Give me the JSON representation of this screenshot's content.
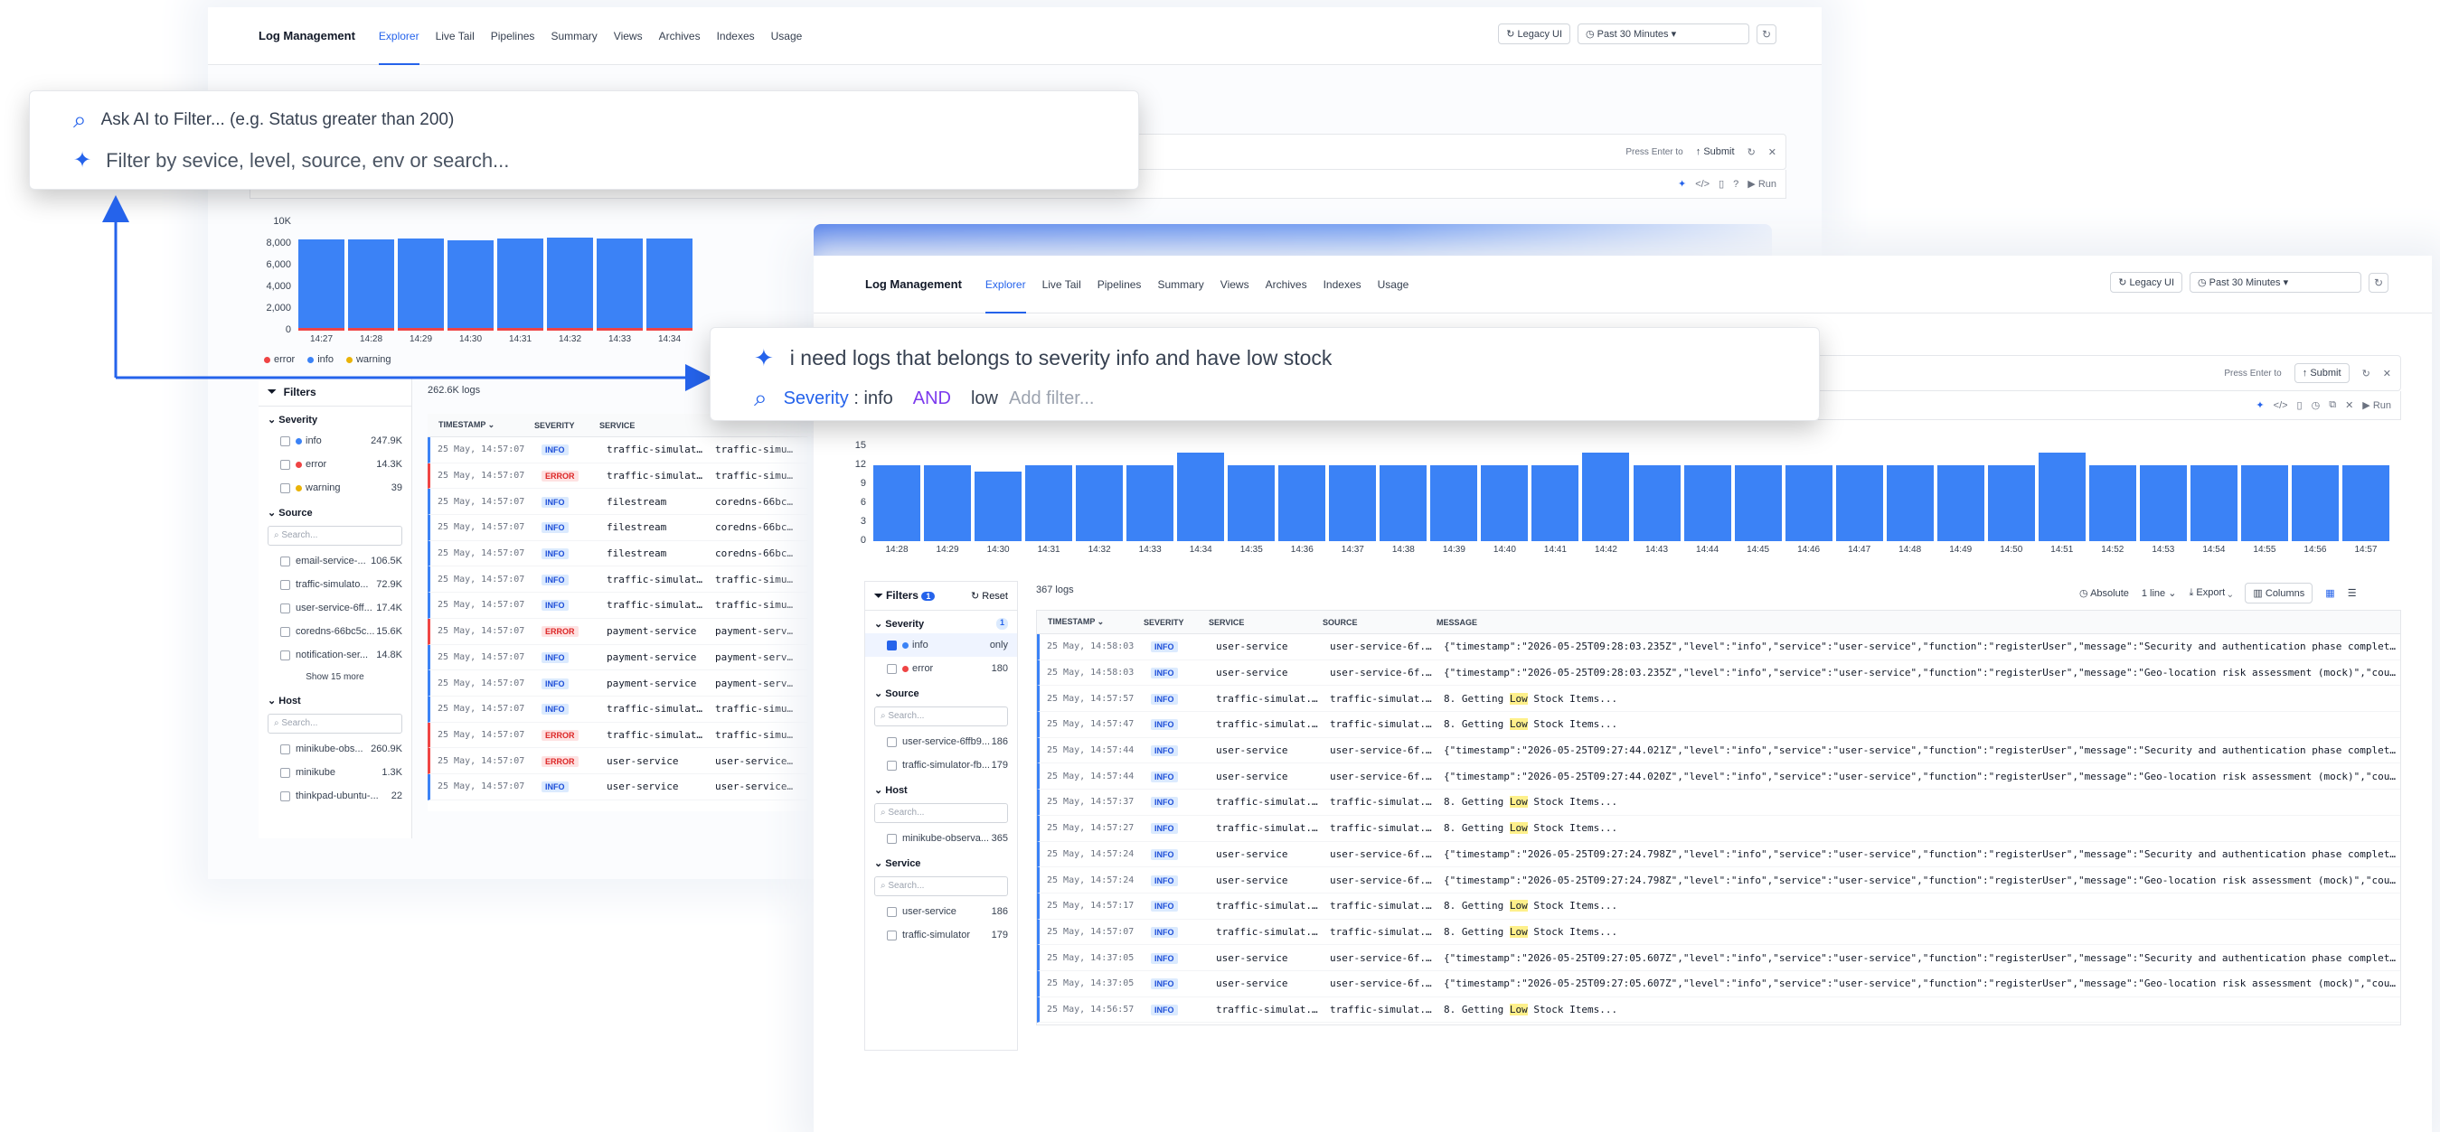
{
  "nav": {
    "brand": "Log Management",
    "tabs": [
      "Explorer",
      "Live Tail",
      "Pipelines",
      "Summary",
      "Views",
      "Archives",
      "Indexes",
      "Usage"
    ],
    "legacy": "Legacy UI",
    "time_range": "Past 30 Minutes"
  },
  "query_bar": {
    "press": "Press",
    "enter": "Enter",
    "to": "to",
    "submit": "Submit",
    "run": "Run"
  },
  "popup1": {
    "ai_line": "Ask AI to Filter... (e.g. Status greater than 200)",
    "filter_line": "Filter by sevice, level, source, env or search..."
  },
  "popup2": {
    "prompt": "i need logs that belongs to severity info and have low stock",
    "filter_key": "Severity",
    "filter_sep": ":",
    "filter_val": "info",
    "and": "AND",
    "term": "low",
    "placeholder": "Add filter..."
  },
  "chart_data": [
    {
      "type": "bar",
      "categories": [
        "14:27",
        "14:28",
        "14:29",
        "14:30",
        "14:31",
        "14:32",
        "14:33",
        "14:34"
      ],
      "series": [
        {
          "name": "info",
          "values": [
            8400,
            8400,
            8500,
            8300,
            8500,
            8600,
            8500,
            8500
          ]
        },
        {
          "name": "error",
          "values": [
            450,
            450,
            450,
            450,
            450,
            450,
            450,
            450
          ]
        }
      ],
      "yticks": [
        "10K",
        "8,000",
        "6,000",
        "4,000",
        "2,000",
        "0"
      ],
      "ylim": [
        0,
        10000
      ],
      "legend": [
        "error",
        "info",
        "warning"
      ],
      "colors": {
        "info": "#3b82f6",
        "error": "#ef4444",
        "warning": "#eab308"
      }
    },
    {
      "type": "bar",
      "categories": [
        "14:28",
        "14:29",
        "14:30",
        "14:31",
        "14:32",
        "14:33",
        "14:34",
        "14:35",
        "14:36",
        "14:37",
        "14:38",
        "14:39",
        "14:40",
        "14:41",
        "14:42",
        "14:43",
        "14:44",
        "14:45",
        "14:46",
        "14:47",
        "14:48",
        "14:49",
        "14:50",
        "14:51",
        "14:52",
        "14:53",
        "14:54",
        "14:55",
        "14:56",
        "14:57"
      ],
      "values": [
        12,
        12,
        11,
        12,
        12,
        12,
        14,
        12,
        12,
        12,
        12,
        12,
        12,
        12,
        14,
        12,
        12,
        12,
        12,
        12,
        12,
        12,
        12,
        14,
        12,
        12,
        12,
        12,
        12,
        12
      ],
      "yticks": [
        "15",
        "12",
        "9",
        "6",
        "3",
        "0"
      ],
      "ylim": [
        0,
        15
      ]
    }
  ],
  "left": {
    "filters_label": "Filters",
    "total": "262.6K logs",
    "severity_label": "Severity",
    "severity": [
      {
        "label": "info",
        "count": "247.9K",
        "color": "#3b82f6"
      },
      {
        "label": "error",
        "count": "14.3K",
        "color": "#ef4444"
      },
      {
        "label": "warning",
        "count": "39",
        "color": "#eab308"
      }
    ],
    "source_label": "Source",
    "search": "Search...",
    "sources": [
      {
        "label": "email-service-...",
        "count": "106.5K"
      },
      {
        "label": "traffic-simulato...",
        "count": "72.9K"
      },
      {
        "label": "user-service-6ff...",
        "count": "17.4K"
      },
      {
        "label": "coredns-66bc5c...",
        "count": "15.6K"
      },
      {
        "label": "notification-ser...",
        "count": "14.8K"
      }
    ],
    "show_more": "Show 15 more",
    "host_label": "Host",
    "hosts": [
      {
        "label": "minikube-obs...",
        "count": "260.9K"
      },
      {
        "label": "minikube",
        "count": "1.3K"
      },
      {
        "label": "thinkpad-ubuntu-...",
        "count": "22"
      }
    ],
    "columns": [
      "TIMESTAMP",
      "SEVERITY",
      "SERVICE"
    ],
    "rows": [
      {
        "ts": "25 May, 14:57:07",
        "sev": "INFO",
        "service": "traffic-simulat...",
        "source": "traffic-simula"
      },
      {
        "ts": "25 May, 14:57:07",
        "sev": "ERROR",
        "service": "traffic-simulat...",
        "source": "traffic-simula"
      },
      {
        "ts": "25 May, 14:57:07",
        "sev": "INFO",
        "service": "filestream",
        "source": "coredns-66bc5c"
      },
      {
        "ts": "25 May, 14:57:07",
        "sev": "INFO",
        "service": "filestream",
        "source": "coredns-66bc5c"
      },
      {
        "ts": "25 May, 14:57:07",
        "sev": "INFO",
        "service": "filestream",
        "source": "coredns-66bc5c"
      },
      {
        "ts": "25 May, 14:57:07",
        "sev": "INFO",
        "service": "traffic-simulat...",
        "source": "traffic-simula"
      },
      {
        "ts": "25 May, 14:57:07",
        "sev": "INFO",
        "service": "traffic-simulat...",
        "source": "traffic-simula"
      },
      {
        "ts": "25 May, 14:57:07",
        "sev": "ERROR",
        "service": "payment-service",
        "source": "payment-servic"
      },
      {
        "ts": "25 May, 14:57:07",
        "sev": "INFO",
        "service": "payment-service",
        "source": "payment-servic"
      },
      {
        "ts": "25 May, 14:57:07",
        "sev": "INFO",
        "service": "payment-service",
        "source": "payment-servic"
      },
      {
        "ts": "25 May, 14:57:07",
        "sev": "INFO",
        "service": "traffic-simulat...",
        "source": "traffic-simula"
      },
      {
        "ts": "25 May, 14:57:07",
        "sev": "ERROR",
        "service": "traffic-simulat...",
        "source": "traffic-simula"
      },
      {
        "ts": "25 May, 14:57:07",
        "sev": "ERROR",
        "service": "user-service",
        "source": "user-service-6"
      },
      {
        "ts": "25 May, 14:57:07",
        "sev": "INFO",
        "service": "user-service",
        "source": "user-service-6"
      }
    ]
  },
  "right": {
    "filters_label": "Filters",
    "filters_count": "1",
    "reset": "Reset",
    "total": "367 logs",
    "absolute": "Absolute",
    "line": "1 line",
    "export": "Export",
    "columns_btn": "Columns",
    "severity_label": "Severity",
    "severity_count": "1",
    "severity": [
      {
        "label": "info",
        "count": "only",
        "color": "#3b82f6",
        "checked": true
      },
      {
        "label": "error",
        "count": "180",
        "color": "#ef4444",
        "checked": false
      }
    ],
    "source_label": "Source",
    "search": "Search...",
    "sources": [
      {
        "label": "user-service-6ffb9...",
        "count": "186"
      },
      {
        "label": "traffic-simulator-fb...",
        "count": "179"
      }
    ],
    "host_label": "Host",
    "hosts": [
      {
        "label": "minikube-observa...",
        "count": "365"
      }
    ],
    "service_label": "Service",
    "services": [
      {
        "label": "user-service",
        "count": "186"
      },
      {
        "label": "traffic-simulator",
        "count": "179"
      }
    ],
    "columns": [
      "TIMESTAMP",
      "SEVERITY",
      "SERVICE",
      "SOURCE",
      "MESSAGE"
    ],
    "rows": [
      {
        "ts": "25 May, 14:58:03",
        "sev": "INFO",
        "service": "user-service",
        "source": "user-service-6f...",
        "msg_pre": "{\"timestamp\":\"2026-05-25T09:28:03.235Z\",\"level\":\"info\",\"service\":\"user-service\",\"function\":\"registerUser\",\"message\":\"Security and authentication phase complete\"",
        "msg_hl": "",
        "msg_post": ""
      },
      {
        "ts": "25 May, 14:58:03",
        "sev": "INFO",
        "service": "user-service",
        "source": "user-service-6f...",
        "msg_pre": "{\"timestamp\":\"2026-05-25T09:28:03.235Z\",\"level\":\"info\",\"service\":\"user-service\",\"function\":\"registerUser\",\"message\":\"Geo-location risk assessment (mock)\",\"count",
        "msg_hl": "",
        "msg_post": ""
      },
      {
        "ts": "25 May, 14:57:57",
        "sev": "INFO",
        "service": "traffic-simulat...",
        "source": "traffic-simulat...",
        "msg_pre": "8. Getting ",
        "msg_hl": "Low",
        "msg_post": " Stock Items..."
      },
      {
        "ts": "25 May, 14:57:47",
        "sev": "INFO",
        "service": "traffic-simulat...",
        "source": "traffic-simulat...",
        "msg_pre": "8. Getting ",
        "msg_hl": "Low",
        "msg_post": " Stock Items..."
      },
      {
        "ts": "25 May, 14:57:44",
        "sev": "INFO",
        "service": "user-service",
        "source": "user-service-6f...",
        "msg_pre": "{\"timestamp\":\"2026-05-25T09:27:44.021Z\",\"level\":\"info\",\"service\":\"user-service\",\"function\":\"registerUser\",\"message\":\"Security and authentication phase complete\"",
        "msg_hl": "",
        "msg_post": ""
      },
      {
        "ts": "25 May, 14:57:44",
        "sev": "INFO",
        "service": "user-service",
        "source": "user-service-6f...",
        "msg_pre": "{\"timestamp\":\"2026-05-25T09:27:44.020Z\",\"level\":\"info\",\"service\":\"user-service\",\"function\":\"registerUser\",\"message\":\"Geo-location risk assessment (mock)\",\"count",
        "msg_hl": "",
        "msg_post": ""
      },
      {
        "ts": "25 May, 14:57:37",
        "sev": "INFO",
        "service": "traffic-simulat...",
        "source": "traffic-simulat...",
        "msg_pre": "8. Getting ",
        "msg_hl": "Low",
        "msg_post": " Stock Items..."
      },
      {
        "ts": "25 May, 14:57:27",
        "sev": "INFO",
        "service": "traffic-simulat...",
        "source": "traffic-simulat...",
        "msg_pre": "8. Getting ",
        "msg_hl": "Low",
        "msg_post": " Stock Items..."
      },
      {
        "ts": "25 May, 14:57:24",
        "sev": "INFO",
        "service": "user-service",
        "source": "user-service-6f...",
        "msg_pre": "{\"timestamp\":\"2026-05-25T09:27:24.798Z\",\"level\":\"info\",\"service\":\"user-service\",\"function\":\"registerUser\",\"message\":\"Security and authentication phase complete\"",
        "msg_hl": "",
        "msg_post": ""
      },
      {
        "ts": "25 May, 14:57:24",
        "sev": "INFO",
        "service": "user-service",
        "source": "user-service-6f...",
        "msg_pre": "{\"timestamp\":\"2026-05-25T09:27:24.798Z\",\"level\":\"info\",\"service\":\"user-service\",\"function\":\"registerUser\",\"message\":\"Geo-location risk assessment (mock)\",\"count",
        "msg_hl": "",
        "msg_post": ""
      },
      {
        "ts": "25 May, 14:57:17",
        "sev": "INFO",
        "service": "traffic-simulat...",
        "source": "traffic-simulat...",
        "msg_pre": "8. Getting ",
        "msg_hl": "Low",
        "msg_post": " Stock Items..."
      },
      {
        "ts": "25 May, 14:57:07",
        "sev": "INFO",
        "service": "traffic-simulat...",
        "source": "traffic-simulat...",
        "msg_pre": "8. Getting ",
        "msg_hl": "Low",
        "msg_post": " Stock Items..."
      },
      {
        "ts": "25 May, 14:37:05",
        "sev": "INFO",
        "service": "user-service",
        "source": "user-service-6f...",
        "msg_pre": "{\"timestamp\":\"2026-05-25T09:27:05.607Z\",\"level\":\"info\",\"service\":\"user-service\",\"function\":\"registerUser\",\"message\":\"Security and authentication phase complete\"",
        "msg_hl": "",
        "msg_post": ""
      },
      {
        "ts": "25 May, 14:37:05",
        "sev": "INFO",
        "service": "user-service",
        "source": "user-service-6f...",
        "msg_pre": "{\"timestamp\":\"2026-05-25T09:27:05.607Z\",\"level\":\"info\",\"service\":\"user-service\",\"function\":\"registerUser\",\"message\":\"Geo-location risk assessment (mock)\",\"count",
        "msg_hl": "",
        "msg_post": ""
      },
      {
        "ts": "25 May, 14:56:57",
        "sev": "INFO",
        "service": "traffic-simulat...",
        "source": "traffic-simulat...",
        "msg_pre": "8. Getting ",
        "msg_hl": "Low",
        "msg_post": " Stock Items..."
      }
    ]
  }
}
